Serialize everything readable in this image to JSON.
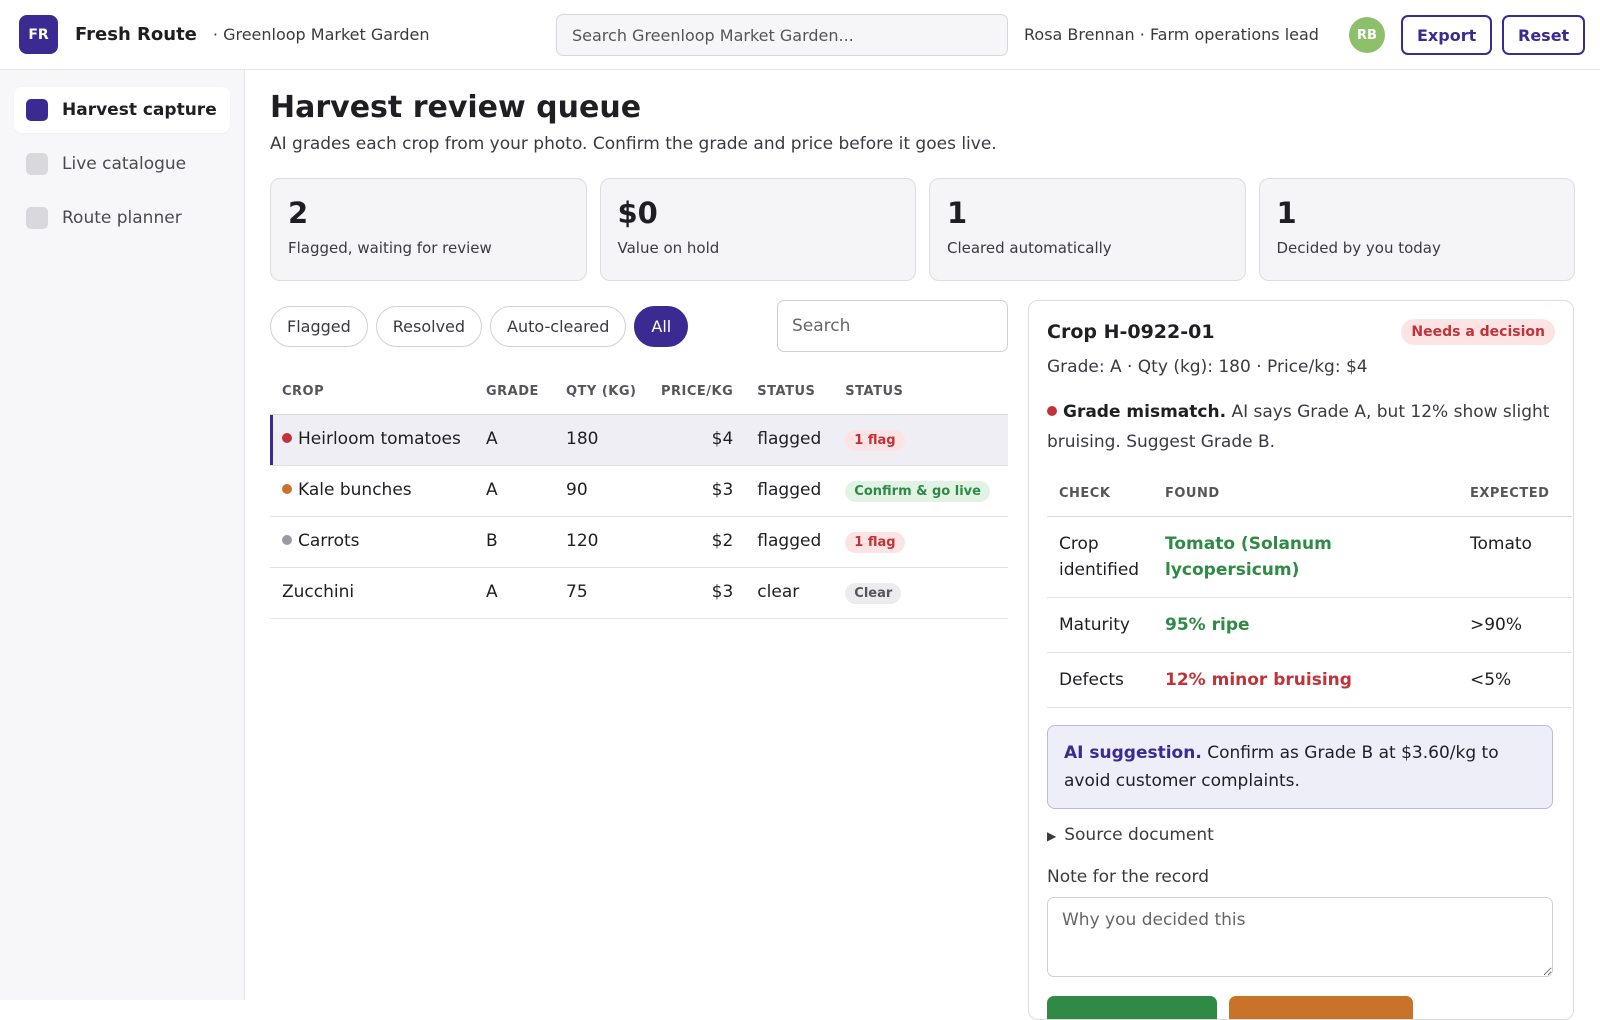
{
  "header": {
    "logo": "FR",
    "brand": "Fresh Route",
    "org": "· Greenloop Market Garden",
    "search_placeholder": "Search Greenloop Market Garden...",
    "user": "Rosa Brennan · Farm operations lead",
    "avatar": "RB",
    "export_label": "Export",
    "reset_label": "Reset"
  },
  "sidebar": {
    "items": [
      {
        "label": "Harvest capture",
        "active": true
      },
      {
        "label": "Live catalogue",
        "active": false
      },
      {
        "label": "Route planner",
        "active": false
      }
    ]
  },
  "page": {
    "title": "Harvest review queue",
    "subtitle": "AI grades each crop from your photo. Confirm the grade and price before it goes live."
  },
  "stats": [
    {
      "value": "2",
      "label": "Flagged, waiting for review"
    },
    {
      "value": "$0",
      "label": "Value on hold"
    },
    {
      "value": "1",
      "label": "Cleared automatically"
    },
    {
      "value": "1",
      "label": "Decided by you today"
    }
  ],
  "filters": {
    "chips": [
      {
        "label": "Flagged",
        "active": false
      },
      {
        "label": "Resolved",
        "active": false
      },
      {
        "label": "Auto-cleared",
        "active": false
      },
      {
        "label": "All",
        "active": true
      }
    ],
    "search_placeholder": "Search"
  },
  "table": {
    "headers": [
      "CROP",
      "GRADE",
      "QTY (KG)",
      "PRICE/KG",
      "STATUS",
      "STATUS"
    ],
    "rows": [
      {
        "crop": "Heirloom tomatoes",
        "dot": "#c1333a",
        "grade": "A",
        "qty": "180",
        "price": "$4",
        "status": "flagged",
        "pill": "1 flag",
        "pill_type": "red",
        "selected": true
      },
      {
        "crop": "Kale bunches",
        "dot": "#c9722a",
        "grade": "A",
        "qty": "90",
        "price": "$3",
        "status": "flagged",
        "pill": "Confirm & go live",
        "pill_type": "green",
        "selected": false
      },
      {
        "crop": "Carrots",
        "dot": "#9a9aa4",
        "grade": "B",
        "qty": "120",
        "price": "$2",
        "status": "flagged",
        "pill": "1 flag",
        "pill_type": "red",
        "selected": false
      },
      {
        "crop": "Zucchini",
        "dot": "",
        "grade": "A",
        "qty": "75",
        "price": "$3",
        "status": "clear",
        "pill": "Clear",
        "pill_type": "gray",
        "selected": false
      }
    ]
  },
  "detail": {
    "title": "Crop H-0922-01",
    "badge": "Needs a decision",
    "meta": "Grade: A · Qty (kg): 180 · Price/kg: $4",
    "warning_bold": "Grade mismatch.",
    "warning_text": " AI says Grade A, but 12% show slight bruising. Suggest Grade B.",
    "checks_headers": [
      "CHECK",
      "FOUND",
      "EXPECTED"
    ],
    "checks": [
      {
        "check": "Crop identified",
        "found": "Tomato (Solanum lycopersicum)",
        "found_type": "good",
        "expected": "Tomato"
      },
      {
        "check": "Maturity",
        "found": "95% ripe",
        "found_type": "good",
        "expected": ">90%"
      },
      {
        "check": "Defects",
        "found": "12% minor bruising",
        "found_type": "bad",
        "expected": "<5%"
      }
    ],
    "suggestion_bold": "AI suggestion.",
    "suggestion_text": " Confirm as Grade B at $3.60/kg to avoid customer complaints.",
    "source_doc": "Source document",
    "note_label": "Note for the record",
    "note_placeholder": "Why you decided this"
  },
  "colors": {
    "accent": "#3b2a91",
    "flag_red": "#c1333a",
    "ok_green": "#2f8a45",
    "action_green": "#2f8a45",
    "action_orange": "#c9722a"
  }
}
